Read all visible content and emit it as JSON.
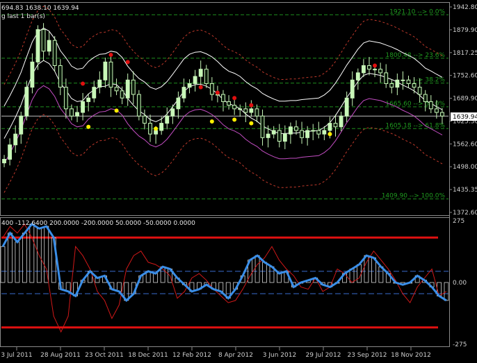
{
  "header": {
    "price_info": "694.83 1638.10 1639.94",
    "sub_info": "g last 1 bar(s)",
    "indicator_info": "400 -112.6400 200.0000 -200.0000 50.0000 -50.0000 0.0000"
  },
  "price_label": "1639.94",
  "colors": {
    "background": "#000000",
    "bull": "#c8f7b8",
    "bear": "#0a1a0a",
    "wick": "#c8f7b8",
    "envelope_white": "#ffffff",
    "envelope_red": "#c0392b",
    "envelope_magenta": "#c44ec4",
    "fib": "#1f8f1f",
    "red_dot": "#e01010",
    "yellow_dot": "#ffee00",
    "cci_line": "#3a8ee8",
    "red_signal": "#d01818",
    "band": "#e01010",
    "dash_blue": "#3a6ed0"
  },
  "chart_data": [
    {
      "type": "candlestick",
      "title": "",
      "y_ticks": [
        "1942.80",
        "1879.90",
        "1817.25",
        "1752.60",
        "1689.90",
        "1625.30",
        "1562.60",
        "1498.00",
        "1435.35",
        "1372.60"
      ],
      "ylim": [
        1372.6,
        1942.8
      ],
      "x_labels": [
        "3 Jul 2011",
        "28 Aug 2011",
        "23 Oct 2011",
        "18 Dec 2011",
        "12 Feb 2012",
        "8 Apr 2012",
        "3 Jun 2012",
        "29 Jul 2012",
        "23 Sep 2012",
        "18 Nov 2012"
      ],
      "current_price": 1639.94,
      "fibonacci": [
        {
          "label": "1921.10 --> 0.0%",
          "value": 1921.1
        },
        {
          "label": "1800.48 --> 23.6%",
          "value": 1800.48
        },
        {
          "label": "--> 38.2%",
          "value": 1731.5
        },
        {
          "label": "1665.60 --> 50.0%",
          "value": 1665.6
        },
        {
          "label": "1605.18 --> 61.8%",
          "value": 1605.18
        },
        {
          "label": "1409.90 --> 100.0%",
          "value": 1409.9
        }
      ],
      "close": [
        1520,
        1560,
        1590,
        1640,
        1720,
        1790,
        1880,
        1820,
        1850,
        1780,
        1720,
        1660,
        1640,
        1650,
        1680,
        1690,
        1720,
        1740,
        1790,
        1720,
        1710,
        1690,
        1740,
        1700,
        1640,
        1620,
        1590,
        1600,
        1620,
        1640,
        1660,
        1690,
        1720,
        1730,
        1750,
        1770,
        1730,
        1700,
        1700,
        1680,
        1670,
        1660,
        1660,
        1650,
        1660,
        1640,
        1580,
        1590,
        1600,
        1570,
        1590,
        1610,
        1600,
        1580,
        1600,
        1600,
        1590,
        1600,
        1620,
        1610,
        1640,
        1690,
        1740,
        1760,
        1780,
        1770,
        1770,
        1760,
        1730,
        1720,
        1740,
        1740,
        1730,
        1720,
        1700,
        1680,
        1660,
        1650,
        1640
      ],
      "red_dot_values": [
        1730,
        1810,
        1790,
        1720,
        1705,
        1690,
        1670,
        1780
      ],
      "yellow_dot_values": [
        1610,
        1655,
        1605,
        1625,
        1630,
        1620,
        1590
      ],
      "cci": {
        "ylim": [
          -275,
          275
        ],
        "y_ticks": [
          "275",
          "0.00",
          "-275"
        ],
        "levels": [
          200,
          0,
          -200
        ],
        "line": [
          160,
          220,
          180,
          220,
          260,
          240,
          250,
          200,
          -30,
          -40,
          -60,
          10,
          50,
          20,
          30,
          -30,
          -40,
          -80,
          -50,
          30,
          50,
          40,
          70,
          60,
          20,
          -10,
          -40,
          -30,
          -10,
          -30,
          -40,
          -70,
          -30,
          30,
          100,
          120,
          90,
          70,
          40,
          50,
          -20,
          0,
          10,
          20,
          -10,
          -20,
          0,
          40,
          60,
          80,
          120,
          110,
          70,
          40,
          0,
          -10,
          0,
          30,
          10,
          -20,
          -60,
          -80
        ],
        "red_line": [
          200,
          250,
          220,
          260,
          200,
          120,
          60,
          -150,
          -220,
          -150,
          160,
          120,
          60,
          -40,
          -80,
          -160,
          -100,
          60,
          120,
          140,
          90,
          80,
          60,
          30,
          -70,
          -40,
          20,
          40,
          10,
          -30,
          -60,
          -90,
          -80,
          -30,
          30,
          80,
          110,
          160,
          100,
          60,
          30,
          -20,
          -30,
          20,
          -40,
          -20,
          60,
          40,
          0,
          20,
          90,
          140,
          100,
          60,
          10,
          -50,
          -90,
          -20,
          20,
          60,
          -60,
          -40
        ]
      }
    }
  ]
}
